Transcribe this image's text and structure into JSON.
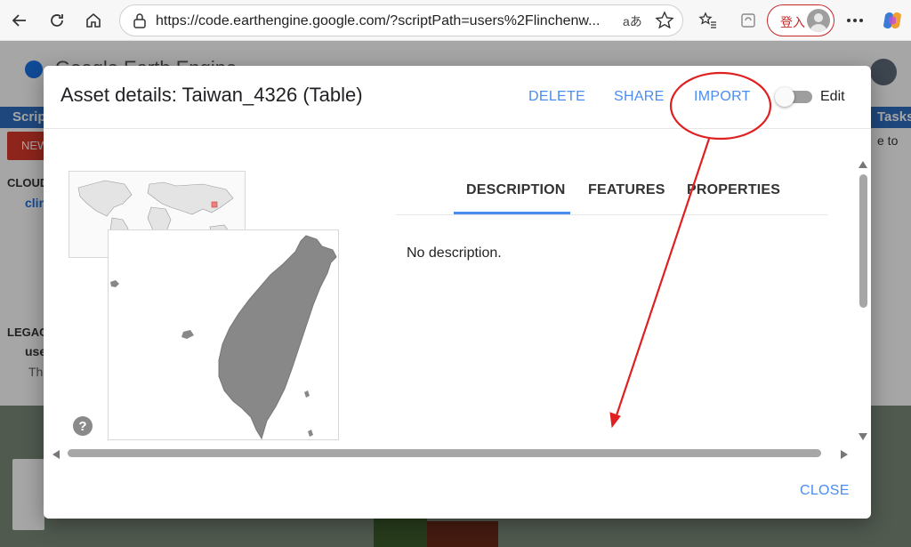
{
  "browser": {
    "url": "https://code.earthengine.google.com/?scriptPath=users%2Flinchenw...",
    "read_aloud_icon_text": "aあ",
    "signin_label": "登入"
  },
  "background_app": {
    "title": "Google Earth Engine",
    "left_tab": "Scrip",
    "right_tab": "Tasks",
    "new_button": "NEW",
    "sidebar_cloud": "CLOUD",
    "sidebar_folder": "clin",
    "sidebar_legacy": "LEGACY",
    "sidebar_users": "use",
    "sidebar_note": "Th",
    "right_text": "e to"
  },
  "dialog": {
    "title": "Asset details: Taiwan_4326 (Table)",
    "actions": {
      "delete": "DELETE",
      "share": "SHARE",
      "import": "IMPORT",
      "edit": "Edit"
    },
    "tabs": [
      "DESCRIPTION",
      "FEATURES",
      "PROPERTIES"
    ],
    "active_tab": "DESCRIPTION",
    "description": "No description.",
    "close": "CLOSE",
    "help_icon": "?"
  },
  "colors": {
    "accent_blue": "#4a8df0",
    "annotation_red": "#e02020",
    "new_button_red": "#d93a2b"
  }
}
